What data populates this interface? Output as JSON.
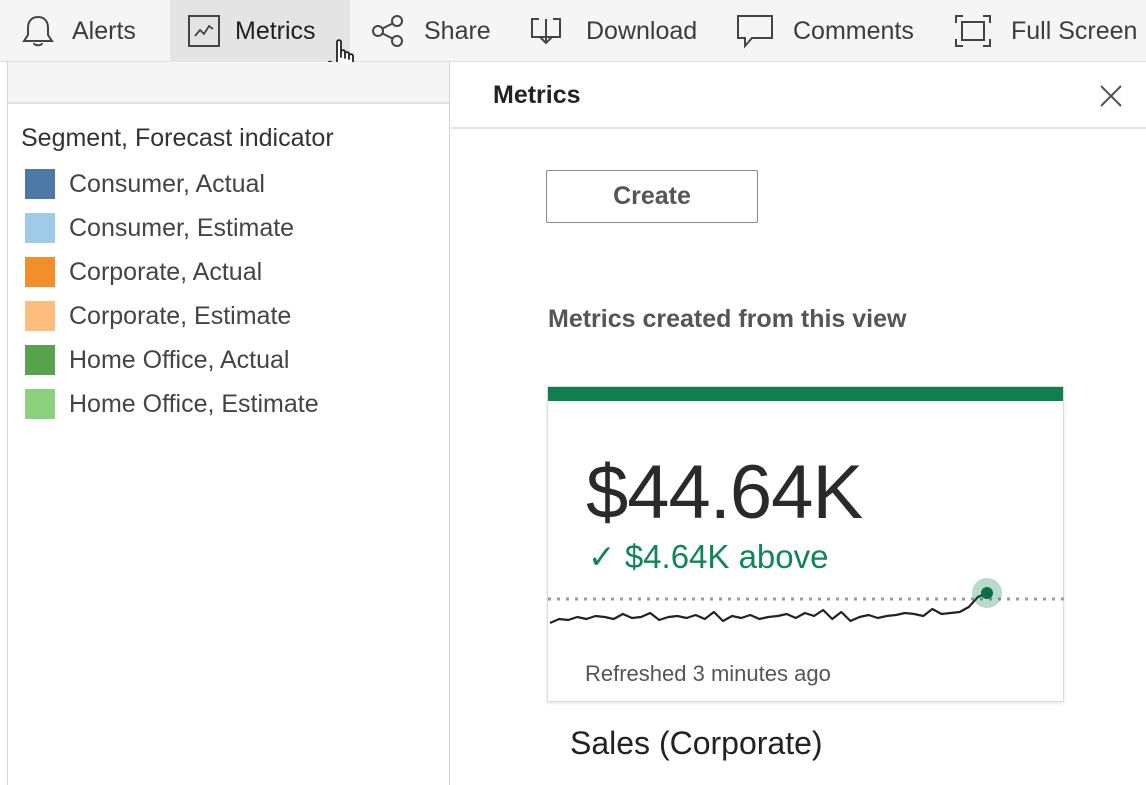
{
  "toolbar": {
    "items": [
      {
        "label": "Alerts",
        "icon": "bell-icon"
      },
      {
        "label": "Metrics",
        "icon": "metrics-chart-icon",
        "active": true
      },
      {
        "label": "Share",
        "icon": "share-icon"
      },
      {
        "label": "Download",
        "icon": "download-icon"
      },
      {
        "label": "Comments",
        "icon": "comment-icon"
      },
      {
        "label": "Full Screen",
        "icon": "fullscreen-icon"
      }
    ]
  },
  "legend": {
    "title": "Segment, Forecast indicator",
    "items": [
      {
        "label": "Consumer, Actual",
        "color": "#4e79a7"
      },
      {
        "label": "Consumer, Estimate",
        "color": "#a0cbe8"
      },
      {
        "label": "Corporate, Actual",
        "color": "#f28e2b"
      },
      {
        "label": "Corporate, Estimate",
        "color": "#ffbe7d"
      },
      {
        "label": "Home Office, Actual",
        "color": "#59a14f"
      },
      {
        "label": "Home Office, Estimate",
        "color": "#8cd17d"
      }
    ]
  },
  "metrics_panel": {
    "title": "Metrics",
    "create_label": "Create",
    "section_title": "Metrics created from this view",
    "card": {
      "value": "$44.64K",
      "delta": "✓ $4.64K above",
      "refreshed": "Refreshed 3 minutes ago",
      "name": "Sales (Corporate)",
      "accent_color": "#0f7f4f",
      "sparkline": [
        34,
        30,
        31,
        28,
        30,
        27,
        28,
        30,
        25,
        29,
        28,
        24,
        31,
        28,
        27,
        29,
        26,
        30,
        23,
        32,
        27,
        29,
        26,
        30,
        28,
        27,
        25,
        29,
        24,
        27,
        21,
        30,
        23,
        32,
        28,
        26,
        29,
        27,
        26,
        24,
        25,
        27,
        20,
        25,
        24,
        23,
        18,
        8,
        4
      ]
    }
  }
}
